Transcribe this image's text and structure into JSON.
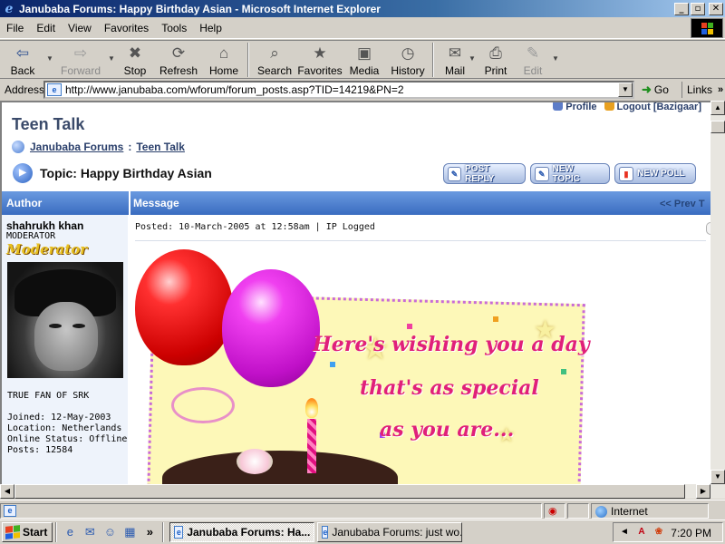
{
  "window": {
    "title": "Janubaba Forums: Happy Birthday Asian - Microsoft Internet Explorer",
    "min_glyph": "_",
    "max_glyph": "▫",
    "close_glyph": "✕"
  },
  "menu": {
    "items": [
      {
        "label": "File"
      },
      {
        "label": "Edit"
      },
      {
        "label": "View"
      },
      {
        "label": "Favorites"
      },
      {
        "label": "Tools"
      },
      {
        "label": "Help"
      }
    ]
  },
  "toolbar": {
    "back": "Back",
    "forward": "Forward",
    "stop": "Stop",
    "refresh": "Refresh",
    "home": "Home",
    "search": "Search",
    "favorites": "Favorites",
    "media": "Media",
    "history": "History",
    "mail": "Mail",
    "print": "Print",
    "edit": "Edit"
  },
  "address": {
    "label": "Address",
    "url": "http://www.janubaba.com/wforum/forum_posts.asp?TID=14219&PN=2",
    "go": "Go",
    "links": "Links"
  },
  "page": {
    "profile_link": "Profile",
    "logout_link": "Logout [Bazigaar]",
    "forum_title": "Teen Talk",
    "breadcrumb": [
      "Janubaba Forums",
      "Teen Talk"
    ],
    "breadcrumb_sep": ":",
    "topic": "Topic: Happy Birthday Asian",
    "buttons": {
      "post_reply": "POST REPLY",
      "new_topic": "NEW TOPIC",
      "new_poll": "NEW POLL"
    },
    "table_header": {
      "author": "Author",
      "message": "Message",
      "prev": "<< Prev T"
    },
    "post": {
      "author_name": "shahrukh khan",
      "rank": "MODERATOR",
      "rank_badge": "Moderator",
      "signature": "TRUE FAN OF SRK",
      "joined": "Joined: 12-May-2003",
      "location": "Location: Netherlands",
      "status": "Online Status: Offline",
      "posts": "Posts: 12584",
      "posted": "Posted: 10-March-2005 at 12:58am | IP Logged",
      "card_lines": [
        "Here's wishing you a day",
        "that's as special",
        "as you are..."
      ]
    }
  },
  "statusbar": {
    "zone": "Internet"
  },
  "taskbar": {
    "start": "Start",
    "tasks": [
      {
        "label": "Janubaba Forums: Ha...",
        "active": true
      },
      {
        "label": "Janubaba Forums: just wo...",
        "active": false
      }
    ],
    "clock": "7:20 PM"
  }
}
